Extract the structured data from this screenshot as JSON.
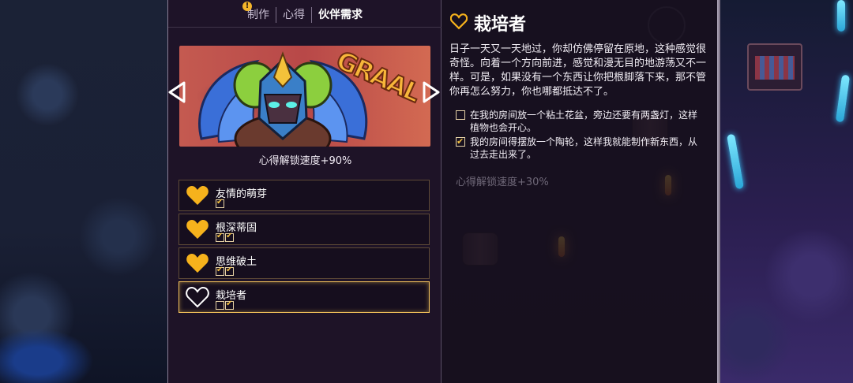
{
  "tabs": [
    {
      "label": "制作",
      "alert": "!"
    },
    {
      "label": "心得"
    },
    {
      "label": "伙伴需求"
    }
  ],
  "banner": {
    "shout": "GRAAL",
    "caption": "心得解锁速度+90%"
  },
  "items": [
    {
      "title": "友情的萌芽",
      "checks": [
        true
      ]
    },
    {
      "title": "根深蒂固",
      "checks": [
        true,
        true
      ]
    },
    {
      "title": "思维破土",
      "checks": [
        true,
        true
      ]
    },
    {
      "title": "栽培者",
      "checks": [
        false,
        true
      ]
    }
  ],
  "detail": {
    "title": "栽培者",
    "description": "日子一天又一天地过，你却仿佛停留在原地，这种感觉很奇怪。向着一个方向前进，感觉和漫无目的地游荡又不一样。可是，如果没有一个东西让你把根脚落下来，那不管你再怎么努力，你也哪都抵达不了。",
    "tasks": [
      {
        "text": "在我的房间放一个粘土花盆，旁边还要有两盏灯，这样植物也会开心。",
        "checked": false
      },
      {
        "text": "我的房间得摆放一个陶轮，这样我就能制作新东西，从过去走出来了。",
        "checked": true
      }
    ],
    "bonus": "心得解锁速度+30%"
  },
  "colors": {
    "accent": "#f3c25a",
    "heart": "#f6b21c",
    "panel": "#1e1428"
  },
  "icons": {
    "prev": "triangle-left",
    "next": "triangle-right",
    "heart": "heart-icon"
  }
}
